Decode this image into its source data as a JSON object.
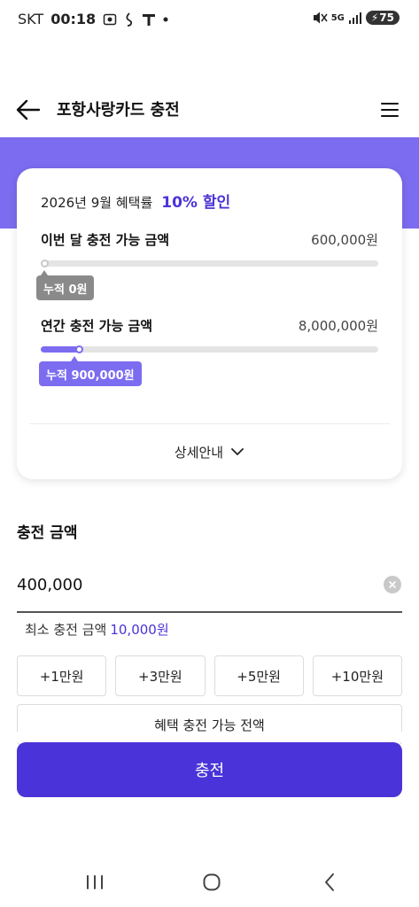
{
  "status_bar": {
    "carrier": "SKT",
    "time": "00:18",
    "network": "5G",
    "battery": "75",
    "icons": [
      "screen-record-icon",
      "notification-icon",
      "t-app-icon",
      "dot-icon",
      "mute-icon",
      "signal-icon",
      "battery-icon"
    ]
  },
  "header": {
    "title": "포항사랑카드 충전",
    "back_icon": "arrow-left-icon",
    "menu_icon": "hamburger-menu-icon"
  },
  "card": {
    "benefit_label": "2026년 9월 혜택률",
    "benefit_rate": "10% 할인",
    "monthly": {
      "title": "이번 달 충전 가능 금액",
      "limit": "600,000원",
      "accumulated": "누적 0원",
      "progress": 0
    },
    "annual": {
      "title": "연간 충전 가능 금액",
      "limit": "8,000,000원",
      "accumulated": "누적 900,000원",
      "progress": 0.1125
    },
    "detail_label": "상세안내"
  },
  "amount": {
    "section_title": "충전 금액",
    "value": "400,000",
    "min_label": "최소 충전 금액",
    "min_amount": "10,000원",
    "quick_buttons": [
      "+1만원",
      "+3만원",
      "+5만원",
      "+10만원"
    ],
    "full_button": "혜택 충전 가능 전액"
  },
  "submit_label": "충전",
  "colors": {
    "accent": "#4a33d8",
    "band": "#7c6cf0",
    "gray_tag": "#8a8a8a"
  }
}
